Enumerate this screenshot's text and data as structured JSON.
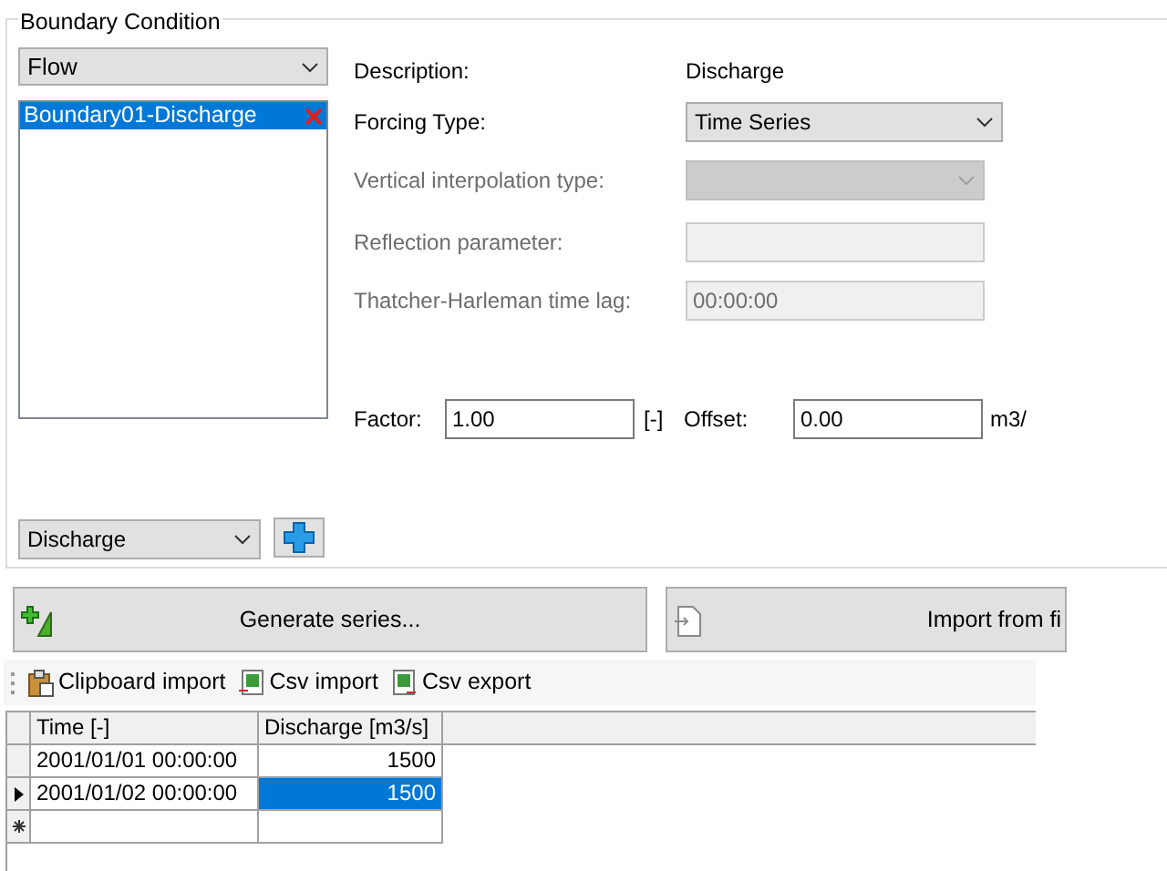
{
  "group": {
    "title": "Boundary Condition"
  },
  "category_dropdown": {
    "value": "Flow"
  },
  "boundaries": [
    {
      "label": "Boundary01-Discharge",
      "selected": true
    }
  ],
  "properties": [
    {
      "kind": "text",
      "label": "Description:",
      "value": "Discharge",
      "disabled": false
    },
    {
      "kind": "dropdown",
      "label": "Forcing Type:",
      "value": "Time Series",
      "disabled": false
    },
    {
      "kind": "dropdown",
      "label": "Vertical interpolation type:",
      "disabled": true
    },
    {
      "kind": "field",
      "label": "Reflection parameter:",
      "disabled": true
    },
    {
      "kind": "field",
      "label": "Thatcher-Harleman time lag:",
      "value": "00:00:00",
      "disabled": true
    }
  ],
  "factor": {
    "label": "Factor:",
    "value": "1.00",
    "unit": "[-]"
  },
  "offset": {
    "label": "Offset:",
    "value": "0.00",
    "unit": "m3/"
  },
  "quantity_dropdown": {
    "value": "Discharge"
  },
  "actions": [
    "Generate series...",
    "Import from fi"
  ],
  "toolbar": [
    "Clipboard import",
    "Csv import",
    "Csv export"
  ],
  "table": {
    "columns": [
      "Time [-]",
      "Discharge [m3/s]"
    ],
    "rows": [
      {
        "kind": "data",
        "current": false,
        "cells": [
          {
            "text": "2001/01/01 00:00:00",
            "selected": false
          },
          {
            "text": "1500",
            "selected": false
          }
        ]
      },
      {
        "kind": "data",
        "current": true,
        "cells": [
          {
            "text": "2001/01/02 00:00:00",
            "selected": false
          },
          {
            "text": "1500",
            "selected": true
          }
        ]
      },
      {
        "kind": "new",
        "current": false
      }
    ]
  }
}
